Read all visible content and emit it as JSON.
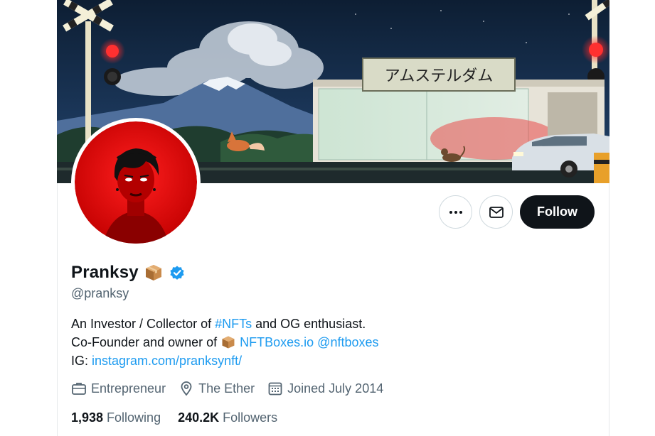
{
  "profile": {
    "display_name": "Pranksy",
    "handle": "@pranksy",
    "name_emoji": "package-box-emoji",
    "verified_badge": "verified-badge-icon",
    "accent_color": "#1d9bf0",
    "follow_button_color": "#0f1419",
    "avatar_color": "#e00000"
  },
  "banner": {
    "sign_text": "アムステルダム",
    "description_icons": [
      "railway-crossing-light",
      "mountain",
      "fox",
      "bus-shelter",
      "cat",
      "car"
    ]
  },
  "actions": {
    "more_icon": "ellipsis-icon",
    "message_icon": "envelope-icon",
    "follow_label": "Follow"
  },
  "bio": {
    "line1_prefix": "An Investor / Collector of ",
    "line1_hashtag": "#NFTs",
    "line1_suffix": " and OG enthusiast.",
    "line2_prefix": "Co-Founder and owner of",
    "line2_link1": "NFTBoxes.io",
    "line2_link2": "@nftboxes",
    "line3_prefix": "IG: ",
    "line3_link": "instagram.com/pranksynft/"
  },
  "meta": {
    "category": "Entrepreneur",
    "location": "The Ether",
    "joined": "Joined July 2014"
  },
  "stats": {
    "following_count": "1,938",
    "following_label": "Following",
    "followers_count": "240.2K",
    "followers_label": "Followers"
  }
}
